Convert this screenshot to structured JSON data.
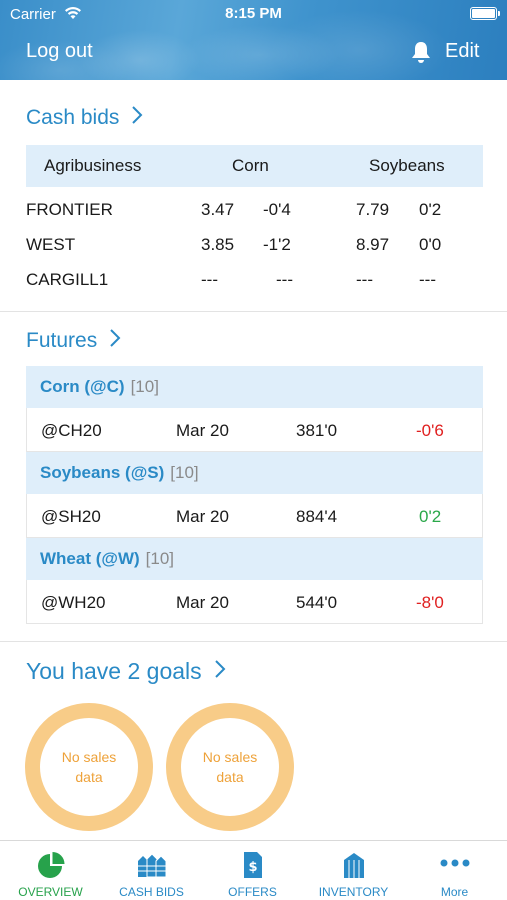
{
  "status_bar": {
    "carrier": "Carrier",
    "time": "8:15 PM"
  },
  "header": {
    "logout_label": "Log out",
    "edit_label": "Edit",
    "bell_icon": "bell-icon"
  },
  "cash_bids": {
    "title": "Cash bids",
    "columns": [
      "Agribusiness",
      "Corn",
      "Soybeans"
    ],
    "rows": [
      {
        "name": "FRONTIER",
        "corn_price": "3.47",
        "corn_change": "-0'4",
        "soy_price": "7.79",
        "soy_change": "0'2"
      },
      {
        "name": "WEST",
        "corn_price": "3.85",
        "corn_change": "-1'2",
        "soy_price": "8.97",
        "soy_change": "0'0"
      },
      {
        "name": "CARGILL1",
        "corn_price": "---",
        "corn_change": "---",
        "soy_price": "---",
        "soy_change": "---"
      }
    ]
  },
  "futures": {
    "title": "Futures",
    "groups": [
      {
        "name": "Corn (@C)",
        "count": "[10]",
        "symbol": "@CH20",
        "month": "Mar 20",
        "price": "381'0",
        "change": "-0'6",
        "change_color": "#e02020"
      },
      {
        "name": "Soybeans (@S)",
        "count": "[10]",
        "symbol": "@SH20",
        "month": "Mar 20",
        "price": "884'4",
        "change": "0'2",
        "change_color": "#2ba84a"
      },
      {
        "name": "Wheat (@W)",
        "count": "[10]",
        "symbol": "@WH20",
        "month": "Mar 20",
        "price": "544'0",
        "change": "-8'0",
        "change_color": "#e02020"
      }
    ]
  },
  "goals": {
    "title": "You have 2 goals",
    "items": [
      {
        "line1": "No sales",
        "line2": "data"
      },
      {
        "line1": "No sales",
        "line2": "data"
      }
    ]
  },
  "tabbar": {
    "tabs": [
      {
        "label": "OVERVIEW",
        "icon": "pie-chart-icon",
        "active": true
      },
      {
        "label": "CASH BIDS",
        "icon": "grain-bins-icon",
        "active": false
      },
      {
        "label": "OFFERS",
        "icon": "document-dollar-icon",
        "active": false
      },
      {
        "label": "INVENTORY",
        "icon": "silo-icon",
        "active": false
      },
      {
        "label": "More",
        "icon": "more-dots-icon",
        "active": false
      }
    ]
  },
  "colors": {
    "accent": "#2a8ac6",
    "active_tab": "#27a24b",
    "goal_ring": "#f8cc88",
    "goal_text": "#eea23a",
    "table_header": "#dfeefa"
  }
}
